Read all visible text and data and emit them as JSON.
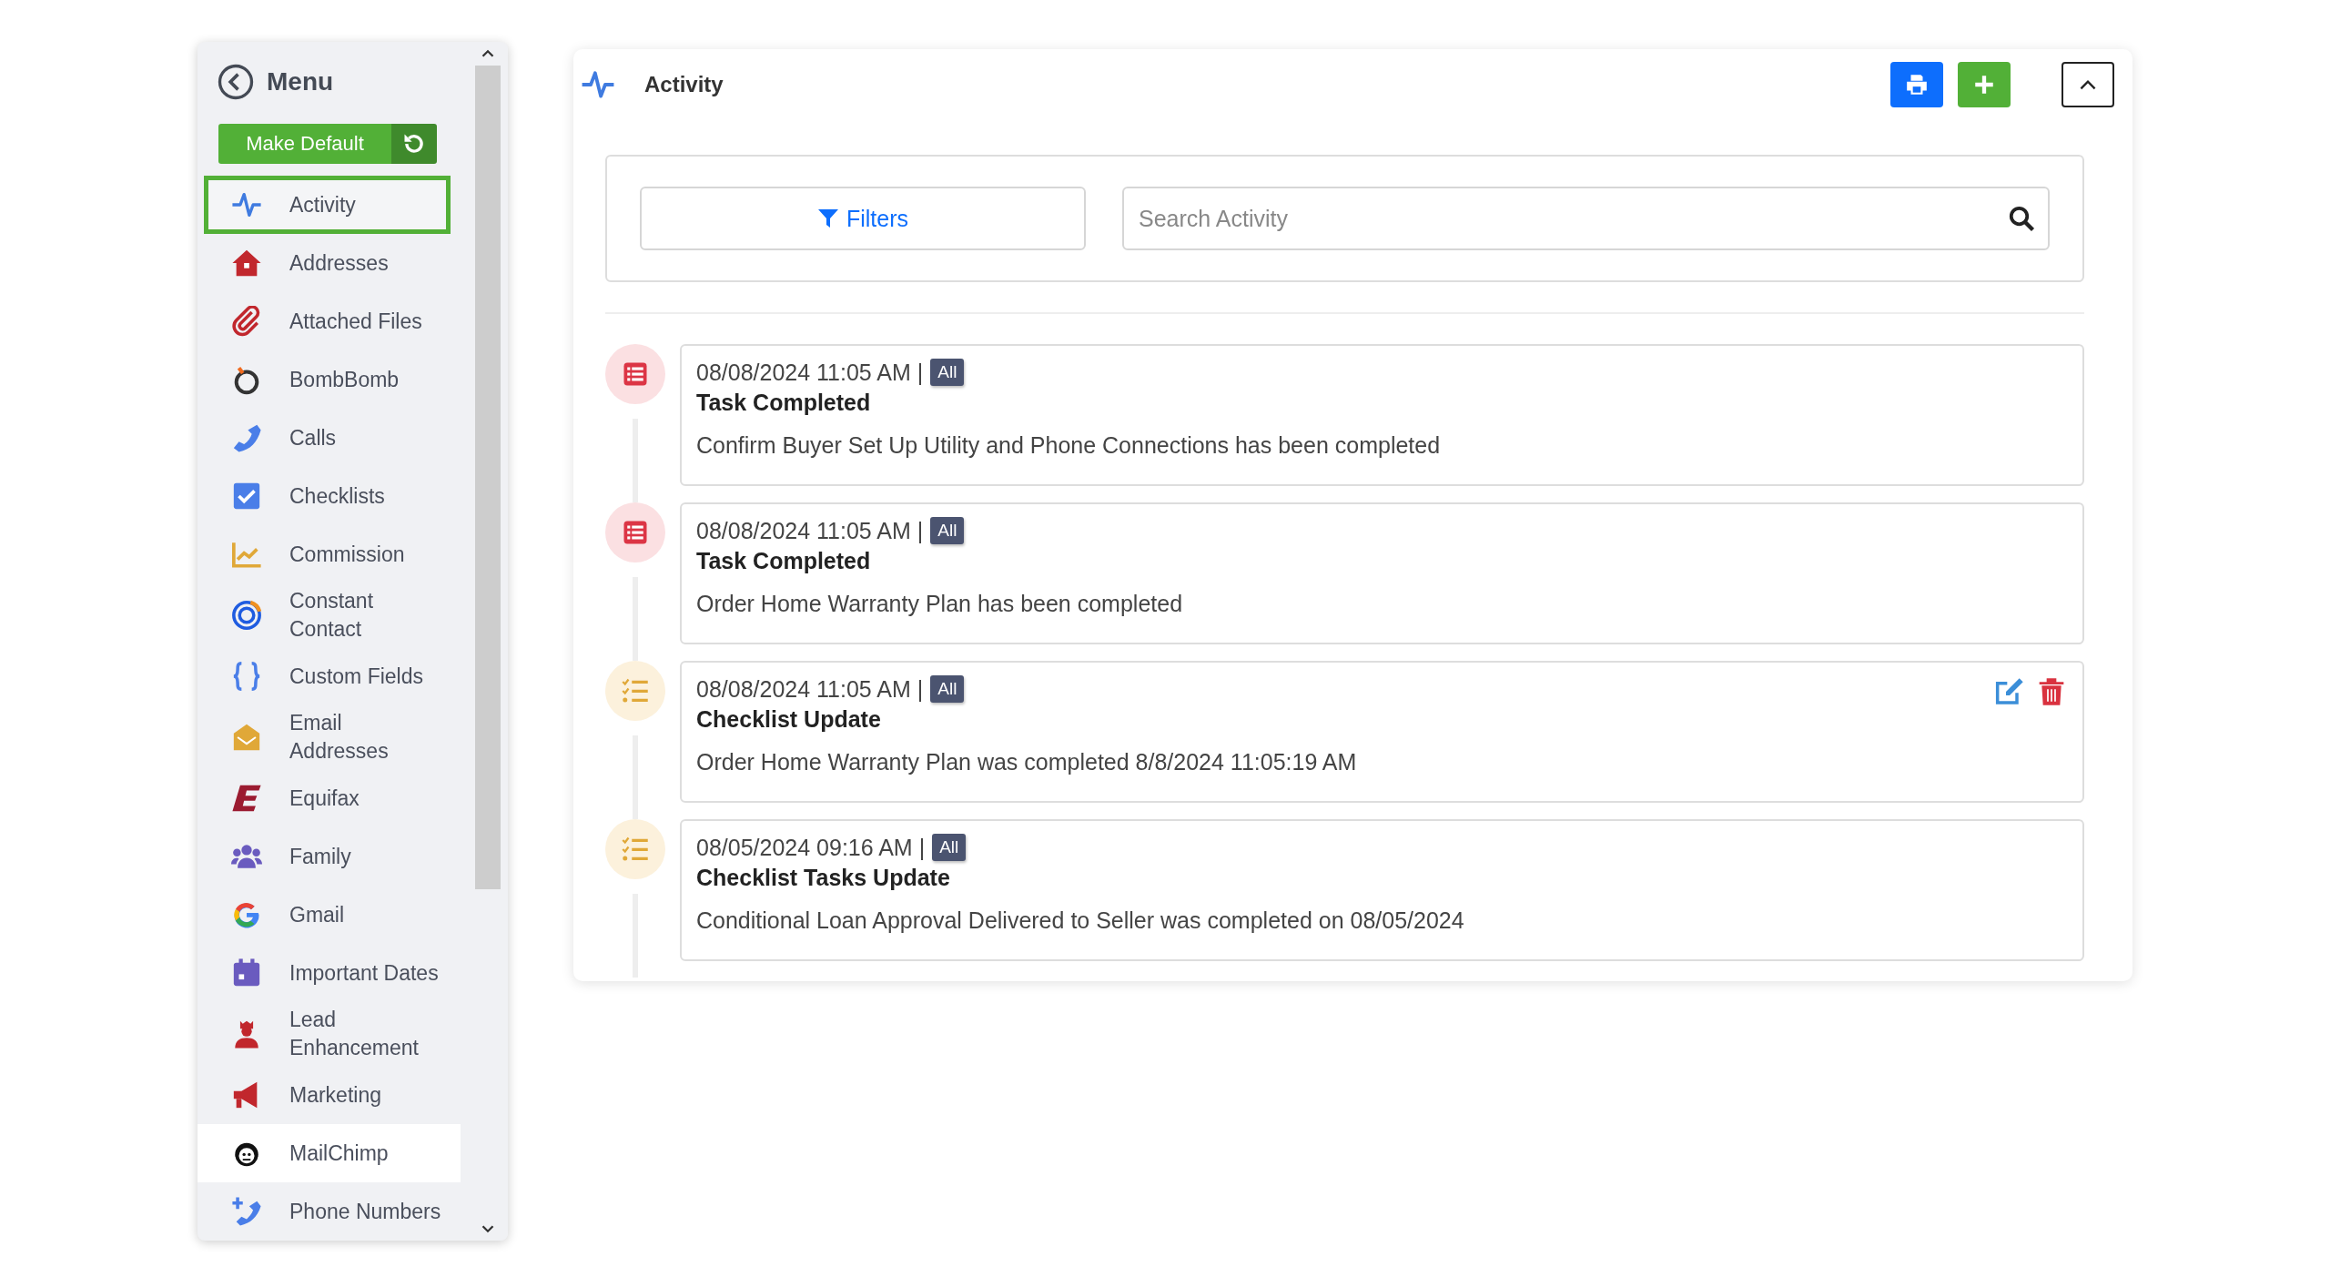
{
  "sidebar": {
    "title": "Menu",
    "make_default_button": "Make Default",
    "items": [
      {
        "label": "Activity",
        "selected": true,
        "hovered": false
      },
      {
        "label": "Addresses",
        "selected": false,
        "hovered": false
      },
      {
        "label": "Attached Files",
        "selected": false,
        "hovered": false
      },
      {
        "label": "BombBomb",
        "selected": false,
        "hovered": false
      },
      {
        "label": "Calls",
        "selected": false,
        "hovered": false
      },
      {
        "label": "Checklists",
        "selected": false,
        "hovered": false
      },
      {
        "label": "Commission",
        "selected": false,
        "hovered": false
      },
      {
        "label": "Constant Contact",
        "selected": false,
        "hovered": false
      },
      {
        "label": "Custom Fields",
        "selected": false,
        "hovered": false
      },
      {
        "label": "Email Addresses",
        "selected": false,
        "hovered": false
      },
      {
        "label": "Equifax",
        "selected": false,
        "hovered": false
      },
      {
        "label": "Family",
        "selected": false,
        "hovered": false
      },
      {
        "label": "Gmail",
        "selected": false,
        "hovered": false
      },
      {
        "label": "Important Dates",
        "selected": false,
        "hovered": false
      },
      {
        "label": "Lead Enhancement",
        "selected": false,
        "hovered": false
      },
      {
        "label": "Marketing",
        "selected": false,
        "hovered": false
      },
      {
        "label": "MailChimp",
        "selected": false,
        "hovered": true
      },
      {
        "label": "Phone Numbers",
        "selected": false,
        "hovered": false
      }
    ]
  },
  "panel": {
    "title": "Activity",
    "filters_button": "Filters",
    "search": {
      "placeholder": "Search Activity"
    },
    "entries": [
      {
        "kind": "task",
        "timestamp": "08/08/2024 11:05 AM |",
        "tag": "All",
        "title": "Task Completed",
        "text": "Confirm Buyer Set Up Utility and Phone Connections has been completed",
        "show_actions": false
      },
      {
        "kind": "task",
        "timestamp": "08/08/2024 11:05 AM |",
        "tag": "All",
        "title": "Task Completed",
        "text": "Order Home Warranty Plan has been completed",
        "show_actions": false
      },
      {
        "kind": "checklist",
        "timestamp": "08/08/2024 11:05 AM |",
        "tag": "All",
        "title": "Checklist Update",
        "text": "Order Home Warranty Plan was completed 8/8/2024 11:05:19 AM",
        "show_actions": true
      },
      {
        "kind": "checklist",
        "timestamp": "08/05/2024 09:16 AM |",
        "tag": "All",
        "title": "Checklist Tasks Update",
        "text": "Conditional Loan Approval Delivered to Seller was completed on 08/05/2024",
        "show_actions": false
      }
    ]
  }
}
